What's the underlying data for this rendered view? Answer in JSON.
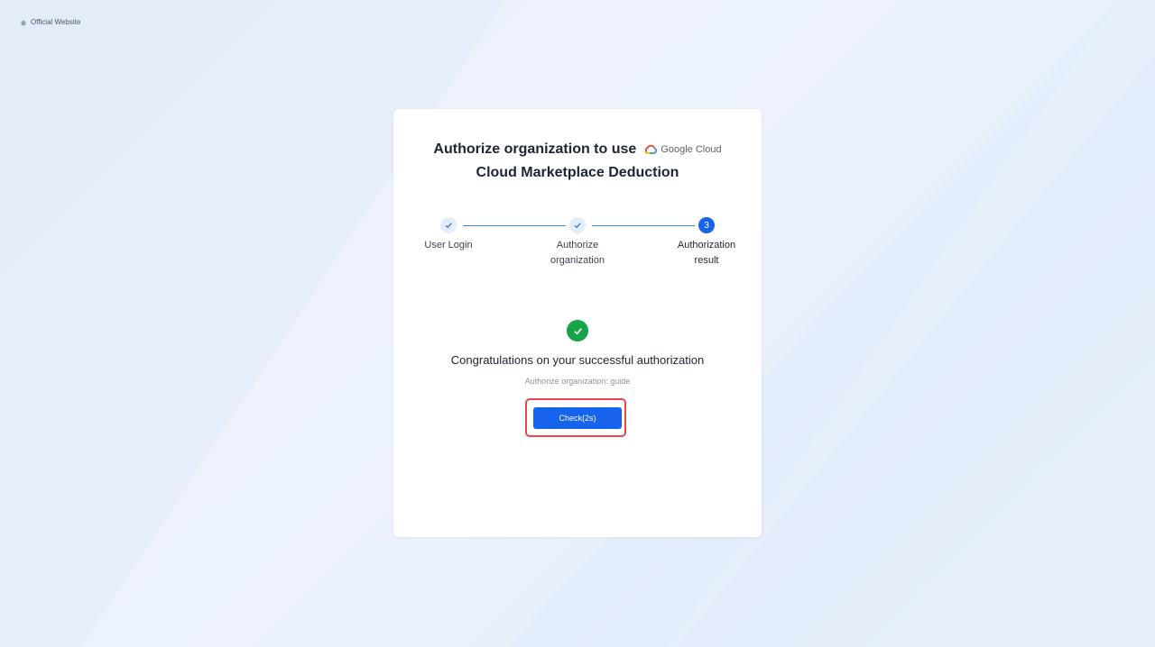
{
  "top_link": {
    "label": "Official Website",
    "icon": "home-icon"
  },
  "header": {
    "title": "Authorize organization to use",
    "logo": {
      "name": "Google Cloud",
      "icon": "google-cloud-logo-icon"
    },
    "subtitle": "Cloud Marketplace Deduction"
  },
  "steps": [
    {
      "label": "User Login",
      "status": "done",
      "indicator": "check-icon"
    },
    {
      "label": "Authorize organization",
      "status": "done",
      "indicator": "check-icon"
    },
    {
      "label": "Authorization result",
      "status": "active",
      "number": "3"
    }
  ],
  "result": {
    "icon": "success-check-icon",
    "message": "Congratulations on your successful authorization",
    "org_text": "Authorize organization: guide",
    "button_label": "Check(2s)"
  },
  "colors": {
    "primary": "#1664ee",
    "success": "#16a34a",
    "highlight": "#e5484d",
    "text": "#1d2433"
  }
}
